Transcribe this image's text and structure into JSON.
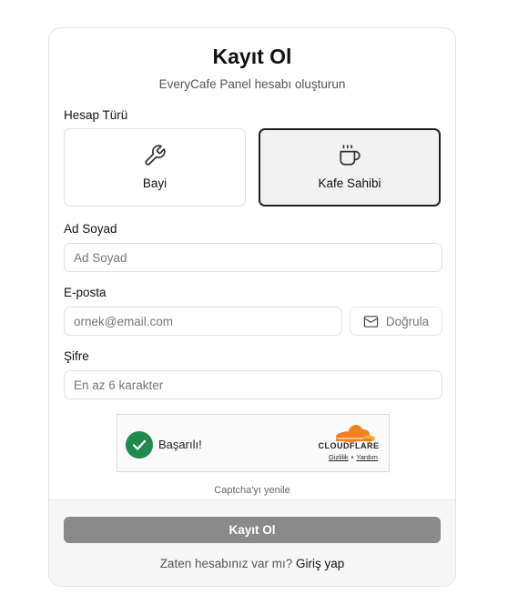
{
  "header": {
    "title": "Kayıt Ol",
    "subtitle": "EveryCafe Panel hesabı oluşturun"
  },
  "account_type": {
    "label": "Hesap Türü",
    "options": [
      {
        "label": "Bayi",
        "icon": "wrench-icon",
        "selected": false
      },
      {
        "label": "Kafe Sahibi",
        "icon": "coffee-cup-icon",
        "selected": true
      }
    ]
  },
  "name": {
    "label": "Ad Soyad",
    "placeholder": "Ad Soyad",
    "value": ""
  },
  "email": {
    "label": "E-posta",
    "placeholder": "ornek@email.com",
    "value": "",
    "verify_label": "Doğrula",
    "verify_icon": "mail-icon"
  },
  "password": {
    "label": "Şifre",
    "placeholder": "En az 6 karakter",
    "value": ""
  },
  "captcha": {
    "status": "Başarılı!",
    "provider": "CLOUDFLARE",
    "privacy_link": "Gizlilik",
    "separator": "•",
    "help_link": "Yardım",
    "refresh_label": "Captcha'yı yenile"
  },
  "footer": {
    "submit_label": "Kayıt Ol",
    "login_prompt": "Zaten hesabınız var mı?",
    "login_link": "Giriş yap"
  },
  "colors": {
    "success": "#1f8a4c",
    "cloudflare_orange": "#f38020",
    "submit_disabled": "#8a8a8a",
    "selected_border": "#222222"
  }
}
